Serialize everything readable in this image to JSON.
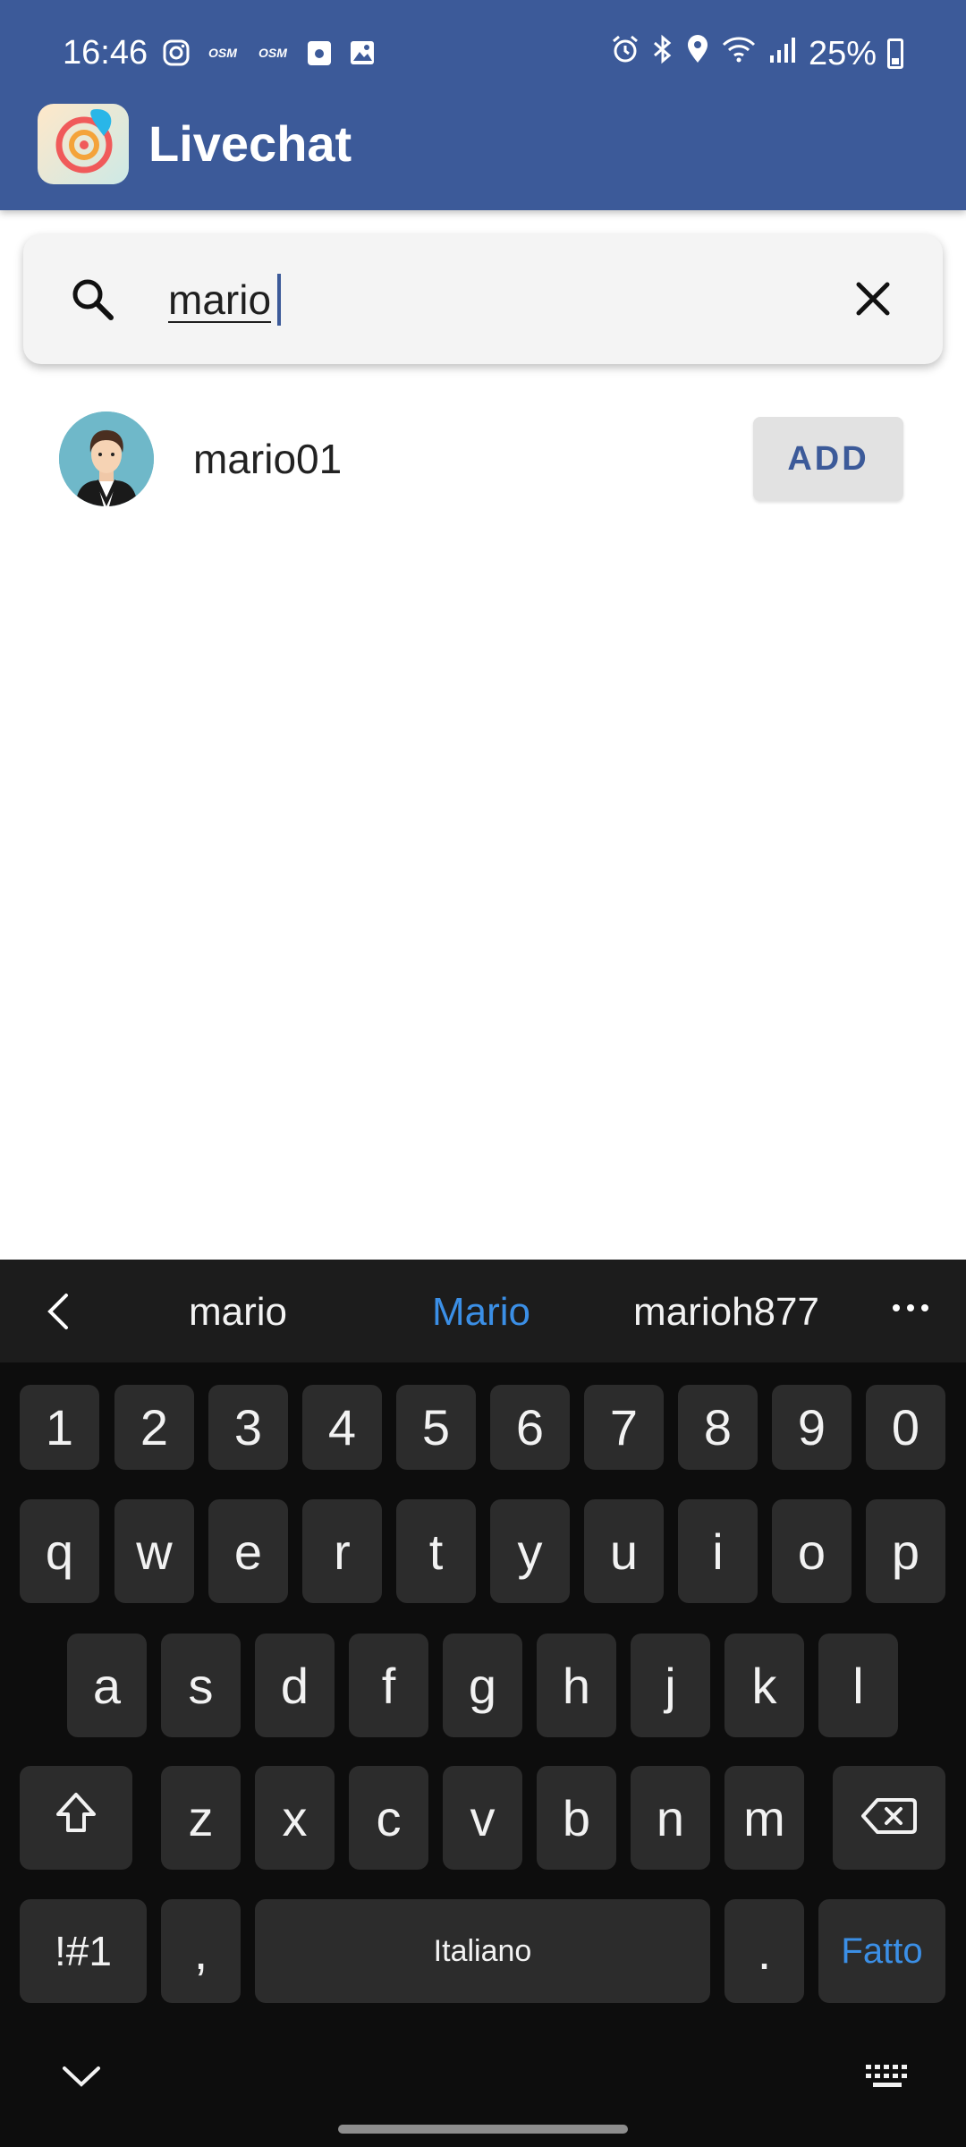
{
  "status_bar": {
    "time": "16:46",
    "left_icons": [
      "instagram-icon",
      "osm-icon",
      "osm-icon",
      "calendar-icon",
      "gallery-icon"
    ],
    "osm_label": "OSM",
    "right_icons": [
      "alarm-icon",
      "bluetooth-icon",
      "location-icon",
      "wifi-icon",
      "signal-icon"
    ],
    "battery": "25%"
  },
  "app_bar": {
    "title": "Livechat",
    "color": "#3c5a99"
  },
  "search": {
    "value": "mario",
    "icon": "search-icon",
    "clear_icon": "close-icon"
  },
  "results": [
    {
      "name": "mario01",
      "action": "ADD"
    }
  ],
  "keyboard": {
    "suggestions": [
      "mario",
      "Mario",
      "marioh877"
    ],
    "number_row": [
      "1",
      "2",
      "3",
      "4",
      "5",
      "6",
      "7",
      "8",
      "9",
      "0"
    ],
    "row1": [
      "q",
      "w",
      "e",
      "r",
      "t",
      "y",
      "u",
      "i",
      "o",
      "p"
    ],
    "row2": [
      "a",
      "s",
      "d",
      "f",
      "g",
      "h",
      "j",
      "k",
      "l"
    ],
    "row3": [
      "z",
      "x",
      "c",
      "v",
      "b",
      "n",
      "m"
    ],
    "symbols_label": "!#1",
    "comma": ",",
    "space_label": "Italiano",
    "period": ".",
    "done_label": "Fatto",
    "accent_color": "#3b8fe6"
  }
}
